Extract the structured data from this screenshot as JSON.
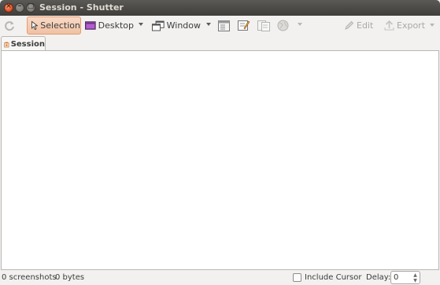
{
  "window": {
    "title": "Session - Shutter",
    "controls": {
      "close": "×",
      "minimize": "–",
      "maximize": "□"
    }
  },
  "toolbar": {
    "refresh_icon": "refresh-icon",
    "selection_label": "Selection",
    "desktop_label": "Desktop",
    "window_label": "Window",
    "edit_label": "Edit",
    "export_label": "Export",
    "accent_selected": "#f0c1a3"
  },
  "tabs": [
    {
      "label": "Session",
      "icon": "session-icon"
    }
  ],
  "statusbar": {
    "screenshot_count": "0 screenshots",
    "total_size": "0 bytes",
    "include_cursor_label": "Include Cursor",
    "include_cursor_checked": false,
    "delay_label": "Delay:",
    "delay_value": "0"
  }
}
